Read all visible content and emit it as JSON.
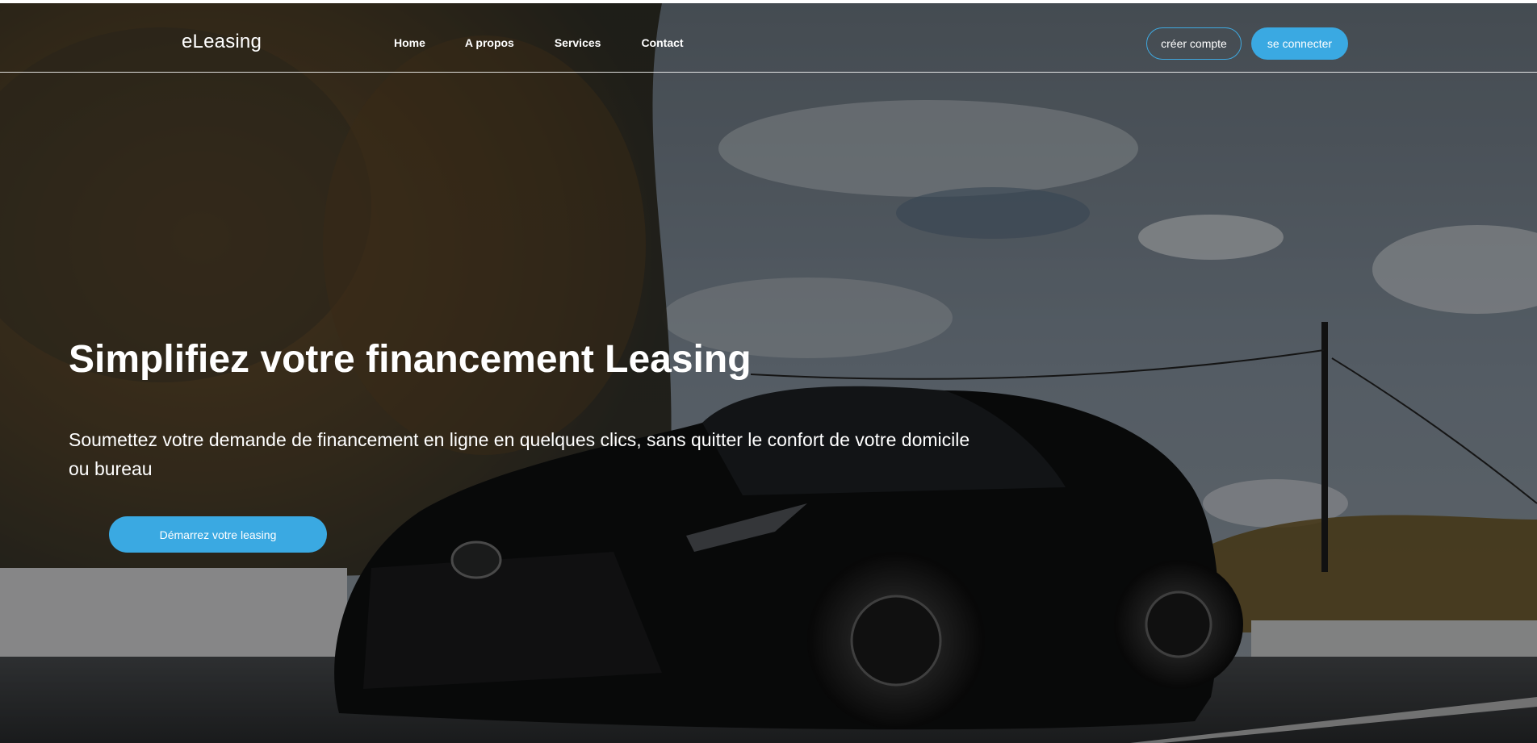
{
  "navbar": {
    "brand": "eLeasing",
    "links": [
      "Home",
      "A propos",
      "Services",
      "Contact"
    ],
    "create_account": "créer compte",
    "login": "se connecter"
  },
  "hero": {
    "title": "Simplifiez votre financement Leasing",
    "subtitle": "Soumettez votre demande de financement en ligne en quelques clics, sans quitter le confort de votre domicile ou bureau",
    "cta": "Démarrez votre leasing",
    "background": "car-on-road-photo"
  },
  "colors": {
    "accent": "#3aa9e2",
    "text": "#ffffff"
  }
}
